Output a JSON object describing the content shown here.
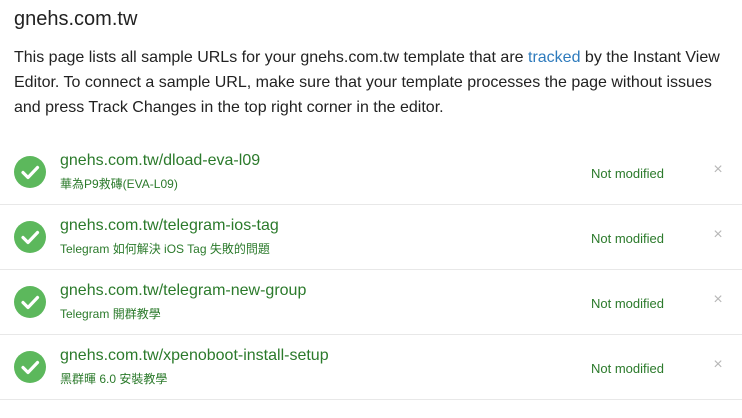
{
  "header": {
    "title": "gnehs.com.tw"
  },
  "intro": {
    "text_before": "This page lists all sample URLs for your gnehs.com.tw template that are ",
    "link_text": "tracked",
    "text_after": " by the Instant View Editor. To connect a sample URL, make sure that your template processes the page without issues and press Track Changes in the top right corner in the editor."
  },
  "samples": [
    {
      "url": "gnehs.com.tw/dload-eva-l09",
      "subtitle": "華為P9救磚(EVA-L09)",
      "status": "Not modified",
      "remove_label": "×"
    },
    {
      "url": "gnehs.com.tw/telegram-ios-tag",
      "subtitle": "Telegram 如何解決 iOS Tag 失敗的問題",
      "status": "Not modified",
      "remove_label": "×"
    },
    {
      "url": "gnehs.com.tw/telegram-new-group",
      "subtitle": "Telegram 開群教學",
      "status": "Not modified",
      "remove_label": "×"
    },
    {
      "url": "gnehs.com.tw/xpenoboot-install-setup",
      "subtitle": "黑群暉 6.0 安裝教學",
      "status": "Not modified",
      "remove_label": "×"
    }
  ],
  "colors": {
    "accent_green": "#5cb85c",
    "text_green": "#2b7a2b",
    "link_blue": "#2e7bbd"
  },
  "icons": {
    "status_icon": "check-circle-icon",
    "remove_icon": "close-icon"
  }
}
